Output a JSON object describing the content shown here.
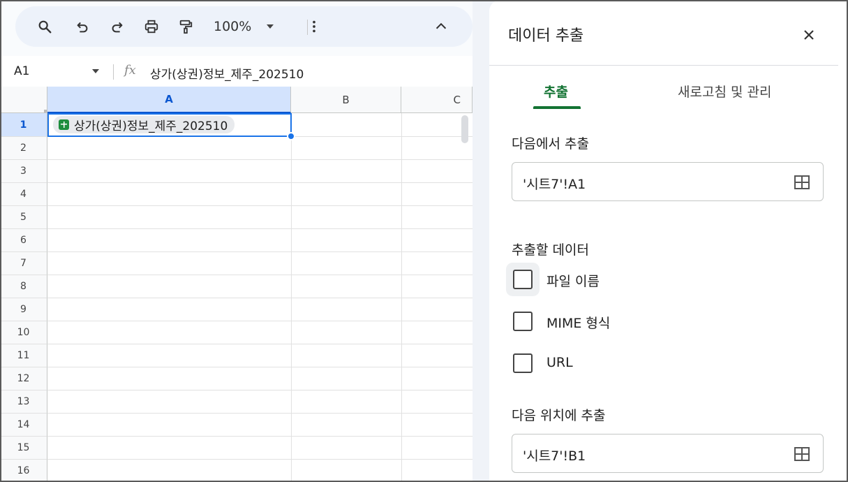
{
  "toolbar": {
    "zoom": "100%",
    "icons": [
      "search-icon",
      "undo-icon",
      "redo-icon",
      "print-icon",
      "paint-format-icon",
      "more-vert-icon",
      "collapse-icon"
    ]
  },
  "namebox": {
    "ref": "A1",
    "fx": "fx",
    "formula": "상가(상권)정보_제주_202510"
  },
  "sheet": {
    "columns": [
      "A",
      "B",
      "C"
    ],
    "rows": [
      "1",
      "2",
      "3",
      "4",
      "5",
      "6",
      "7",
      "8",
      "9",
      "10",
      "11",
      "12",
      "13",
      "14",
      "15",
      "16"
    ],
    "cell_A1": "상가(상권)정보_제주_202510"
  },
  "panel": {
    "title": "데이터 추출",
    "tabs": {
      "extract": "추출",
      "refresh": "새로고침 및 관리"
    },
    "source_label": "다음에서 추출",
    "source_value": "'시트7'!A1",
    "data_label": "추출할 데이터",
    "options": {
      "file_name": "파일 이름",
      "mime": "MIME 형식",
      "url": "URL"
    },
    "dest_label": "다음 위치에 추출",
    "dest_value": "'시트7'!B1"
  },
  "colors": {
    "accent_green": "#137333",
    "selection_blue": "#1a73e8",
    "chip_green": "#1e8e3e"
  }
}
